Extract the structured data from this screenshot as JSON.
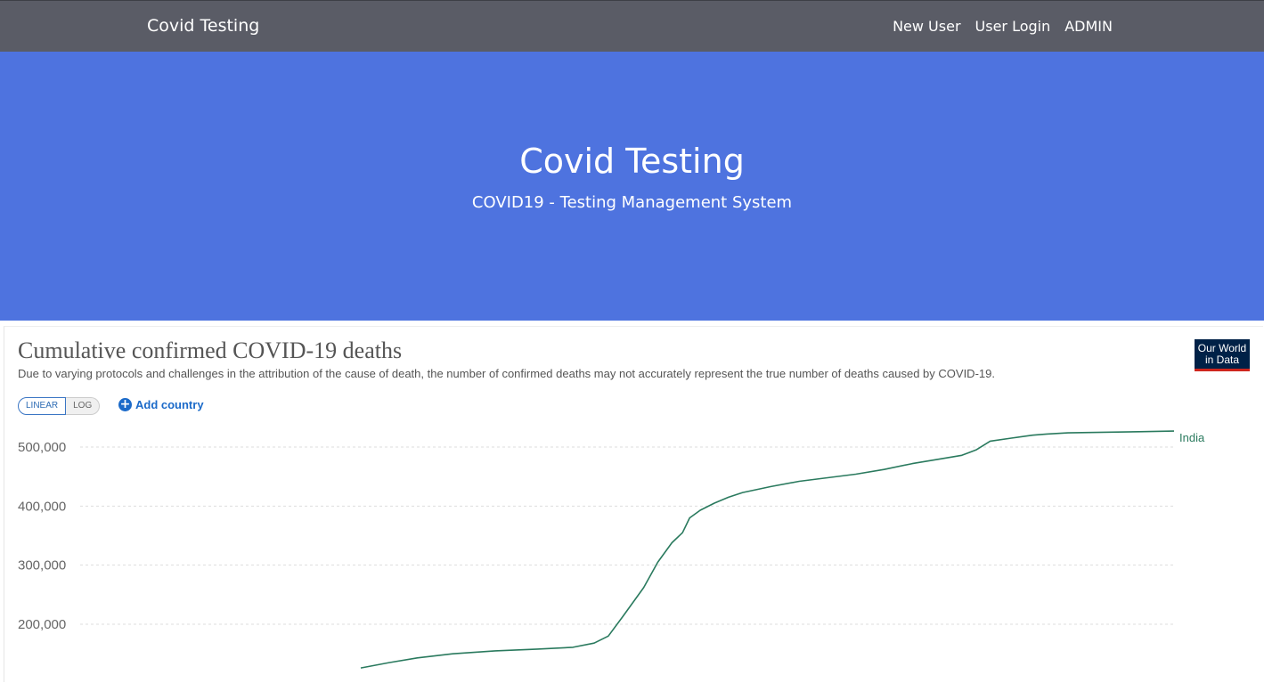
{
  "navbar": {
    "brand": "Covid Testing",
    "links": [
      "New User",
      "User Login",
      "ADMIN"
    ]
  },
  "hero": {
    "title": "Covid Testing",
    "subtitle": "COVID19 - Testing Management System"
  },
  "chart_panel": {
    "title": "Cumulative confirmed COVID-19 deaths",
    "subtitle": "Due to varying protocols and challenges in the attribution of the cause of death, the number of confirmed deaths may not accurately represent the true number of deaths caused by COVID-19.",
    "logo_line1": "Our World",
    "logo_line2": "in Data",
    "scale_linear": "LINEAR",
    "scale_log": "LOG",
    "add_country": "Add country"
  },
  "colors": {
    "navbar": "#5a5c66",
    "hero": "#4e73df",
    "series": "#2a7a5e",
    "link": "#1b6ac9"
  },
  "chart_data": {
    "type": "line",
    "title": "Cumulative confirmed COVID-19 deaths",
    "y_ticks": [
      200000,
      300000,
      400000,
      500000
    ],
    "y_tick_labels": [
      "200,000",
      "300,000",
      "400,000",
      "500,000"
    ],
    "grid": true,
    "series": [
      {
        "name": "India",
        "points": [
          [
            0.0,
            126000
          ],
          [
            0.04,
            135000
          ],
          [
            0.08,
            143000
          ],
          [
            0.13,
            150000
          ],
          [
            0.19,
            155000
          ],
          [
            0.25,
            158000
          ],
          [
            0.3,
            161000
          ],
          [
            0.33,
            168000
          ],
          [
            0.35,
            180000
          ],
          [
            0.37,
            212000
          ],
          [
            0.4,
            262000
          ],
          [
            0.42,
            305000
          ],
          [
            0.44,
            338000
          ],
          [
            0.455,
            355000
          ],
          [
            0.465,
            380000
          ],
          [
            0.48,
            393000
          ],
          [
            0.5,
            405000
          ],
          [
            0.52,
            415000
          ],
          [
            0.54,
            423000
          ],
          [
            0.58,
            433000
          ],
          [
            0.62,
            442000
          ],
          [
            0.66,
            448000
          ],
          [
            0.7,
            454000
          ],
          [
            0.74,
            462000
          ],
          [
            0.78,
            472000
          ],
          [
            0.82,
            480000
          ],
          [
            0.85,
            486000
          ],
          [
            0.87,
            495000
          ],
          [
            0.89,
            510000
          ],
          [
            0.92,
            515000
          ],
          [
            0.95,
            520000
          ],
          [
            0.97,
            522000
          ],
          [
            1.0,
            524000
          ],
          [
            1.05,
            525000
          ],
          [
            1.1,
            526000
          ],
          [
            1.15,
            527000
          ]
        ]
      }
    ]
  }
}
